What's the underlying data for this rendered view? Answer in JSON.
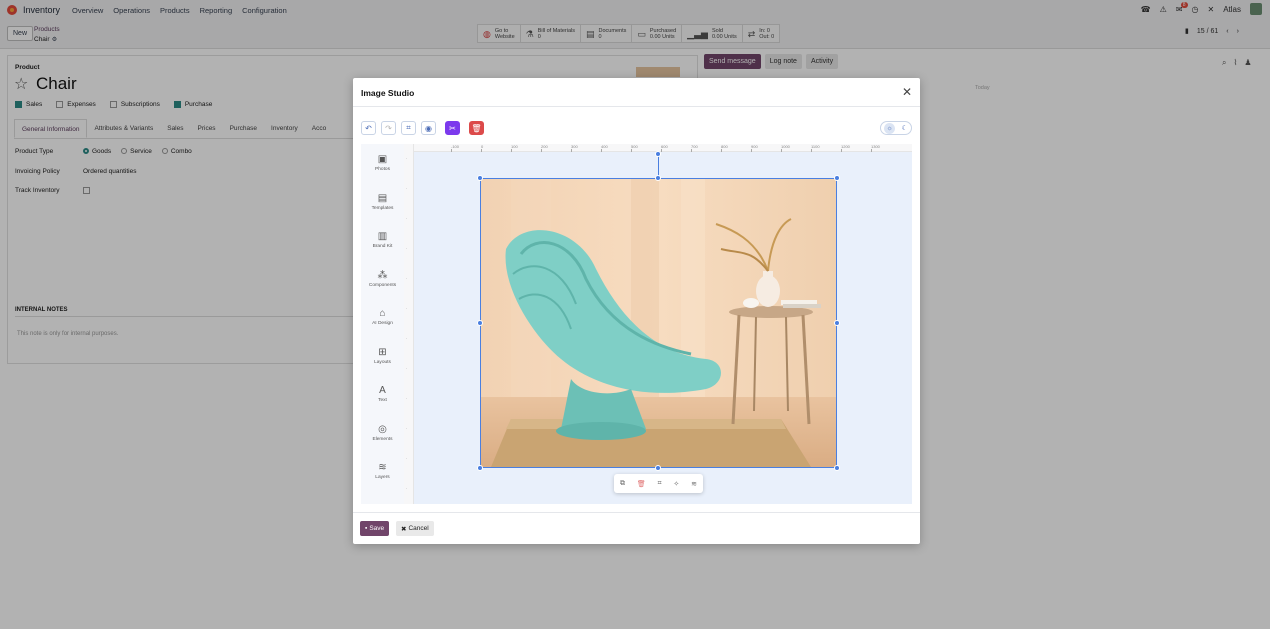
{
  "navbar": {
    "app_name": "Inventory",
    "menu": [
      "Overview",
      "Operations",
      "Products",
      "Reporting",
      "Configuration"
    ],
    "messages_count": "8",
    "company": "Atlas"
  },
  "control": {
    "new_label": "New",
    "breadcrumb_parent": "Products",
    "breadcrumb_current": "Chair",
    "smart_buttons": [
      {
        "line1": "Go to",
        "line2": "Website"
      },
      {
        "line1": "Bill of Materials",
        "line2": "0"
      },
      {
        "line1": "Documents",
        "line2": "0"
      },
      {
        "line1": "Purchased",
        "line2": "0.00 Units"
      },
      {
        "line1": "Sold",
        "line2": "0.00 Units"
      },
      {
        "line1": "In: 0",
        "line2": "Out: 0"
      }
    ],
    "pager": "15 / 61"
  },
  "form": {
    "product_label": "Product",
    "title": "Chair",
    "checkboxes": [
      {
        "label": "Sales",
        "checked": true
      },
      {
        "label": "Expenses",
        "checked": false
      },
      {
        "label": "Subscriptions",
        "checked": false
      },
      {
        "label": "Purchase",
        "checked": true
      }
    ],
    "tabs": [
      "General Information",
      "Attributes & Variants",
      "Sales",
      "Prices",
      "Purchase",
      "Inventory",
      "Acco"
    ],
    "product_type_label": "Product Type",
    "product_type_options": [
      "Goods",
      "Service",
      "Combo"
    ],
    "invoicing_label": "Invoicing Policy",
    "invoicing_value": "Ordered quantities",
    "track_label": "Track Inventory",
    "internal_notes_label": "INTERNAL NOTES",
    "internal_notes_placeholder": "This note is only for internal purposes."
  },
  "chatter": {
    "send_message": "Send message",
    "log_note": "Log note",
    "activity": "Activity",
    "today": "Today"
  },
  "modal": {
    "title": "Image Studio",
    "sidebar": [
      {
        "label": "Photos",
        "icon": "photos-icon"
      },
      {
        "label": "Templates",
        "icon": "templates-icon"
      },
      {
        "label": "Brand Kit",
        "icon": "brand-kit-icon"
      },
      {
        "label": "Components",
        "icon": "components-icon"
      },
      {
        "label": "AI Design",
        "icon": "ai-design-icon"
      },
      {
        "label": "Layouts",
        "icon": "layouts-icon"
      },
      {
        "label": "Text",
        "icon": "text-icon"
      },
      {
        "label": "Elements",
        "icon": "elements-icon"
      },
      {
        "label": "Layers",
        "icon": "layers-icon"
      }
    ],
    "h_ruler": [
      "-100",
      "0",
      "100",
      "200",
      "300",
      "400",
      "500",
      "600",
      "700",
      "800",
      "900",
      "1000",
      "1100",
      "1200",
      "1300"
    ],
    "save_label": "Save",
    "cancel_label": "Cancel"
  },
  "colors": {
    "brand": "#71456a",
    "accent_teal": "#2b8a86",
    "selection_blue": "#4a7fe0",
    "bg_remove_purple": "#7c3aed",
    "delete_red": "#dc4a4a"
  }
}
